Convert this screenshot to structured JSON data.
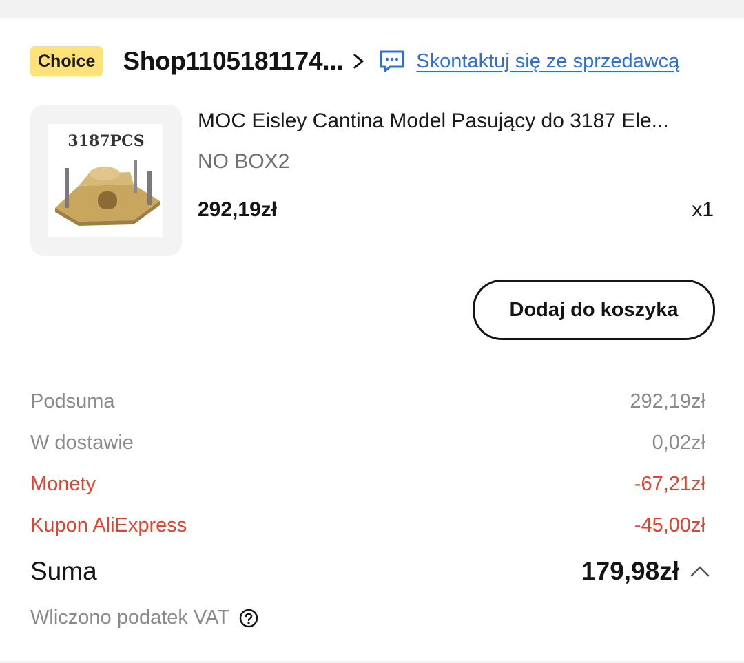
{
  "shop": {
    "badge": "Choice",
    "name": "Shop1105181174...",
    "contact_label": "Skontaktuj się ze sprzedawcą"
  },
  "product": {
    "image_text": "3187PCS",
    "title": "MOC Eisley Cantina Model Pasujący do 3187 Ele...",
    "variant": "NO BOX2",
    "price": "292,19zł",
    "quantity": "x1",
    "add_to_cart_label": "Dodaj do koszyka"
  },
  "summary": {
    "subtotal_label": "Podsuma",
    "subtotal_value": "292,19zł",
    "shipping_label": "W dostawie",
    "shipping_value": "0,02zł",
    "coins_label": "Monety",
    "coins_value": "-67,21zł",
    "coupon_label": "Kupon AliExpress",
    "coupon_value": "-45,00zł",
    "total_label": "Suma",
    "total_value": "179,98zł",
    "vat_label": "Wliczono podatek VAT"
  },
  "colors": {
    "badge_bg": "#fde27a",
    "link": "#2e6fd6",
    "discount": "#e0442f",
    "muted": "#8a8a8a"
  },
  "icons": {
    "shop_chevron": "chevron-right-icon",
    "chat": "chat-icon",
    "expand": "chevron-up-icon",
    "help": "help-circle-icon"
  }
}
